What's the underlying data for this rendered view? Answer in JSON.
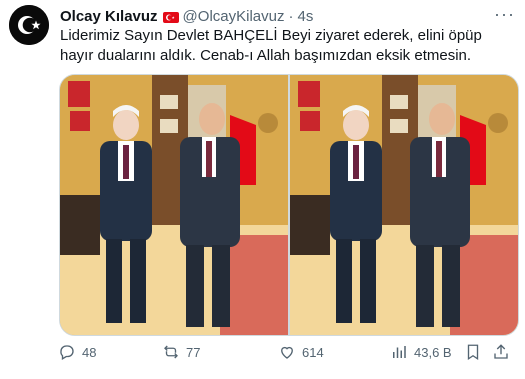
{
  "tweet": {
    "author_name": "Olcay Kılavuz",
    "handle": "@OlcayKilavuz",
    "separator": "·",
    "time": "4s",
    "text": "Liderimiz Sayın Devlet BAHÇELİ Beyi ziyaret ederek, elini öpüp hayır dualarını aldık. Cenab-ı Allah başımızdan eksik etmesin.",
    "more_label": "···"
  },
  "actions": {
    "replies": "48",
    "reposts": "77",
    "likes": "614",
    "views": "43,6 B"
  },
  "icons": {
    "avatar": "crescent-star-icon",
    "flag": "turkey-flag-icon",
    "reply": "reply-icon",
    "repost": "repost-icon",
    "like": "heart-icon",
    "views": "views-icon",
    "bookmark": "bookmark-icon",
    "share": "share-icon"
  },
  "colors": {
    "muted": "#536471",
    "text": "#0f1419",
    "flag_red": "#e30a17"
  }
}
